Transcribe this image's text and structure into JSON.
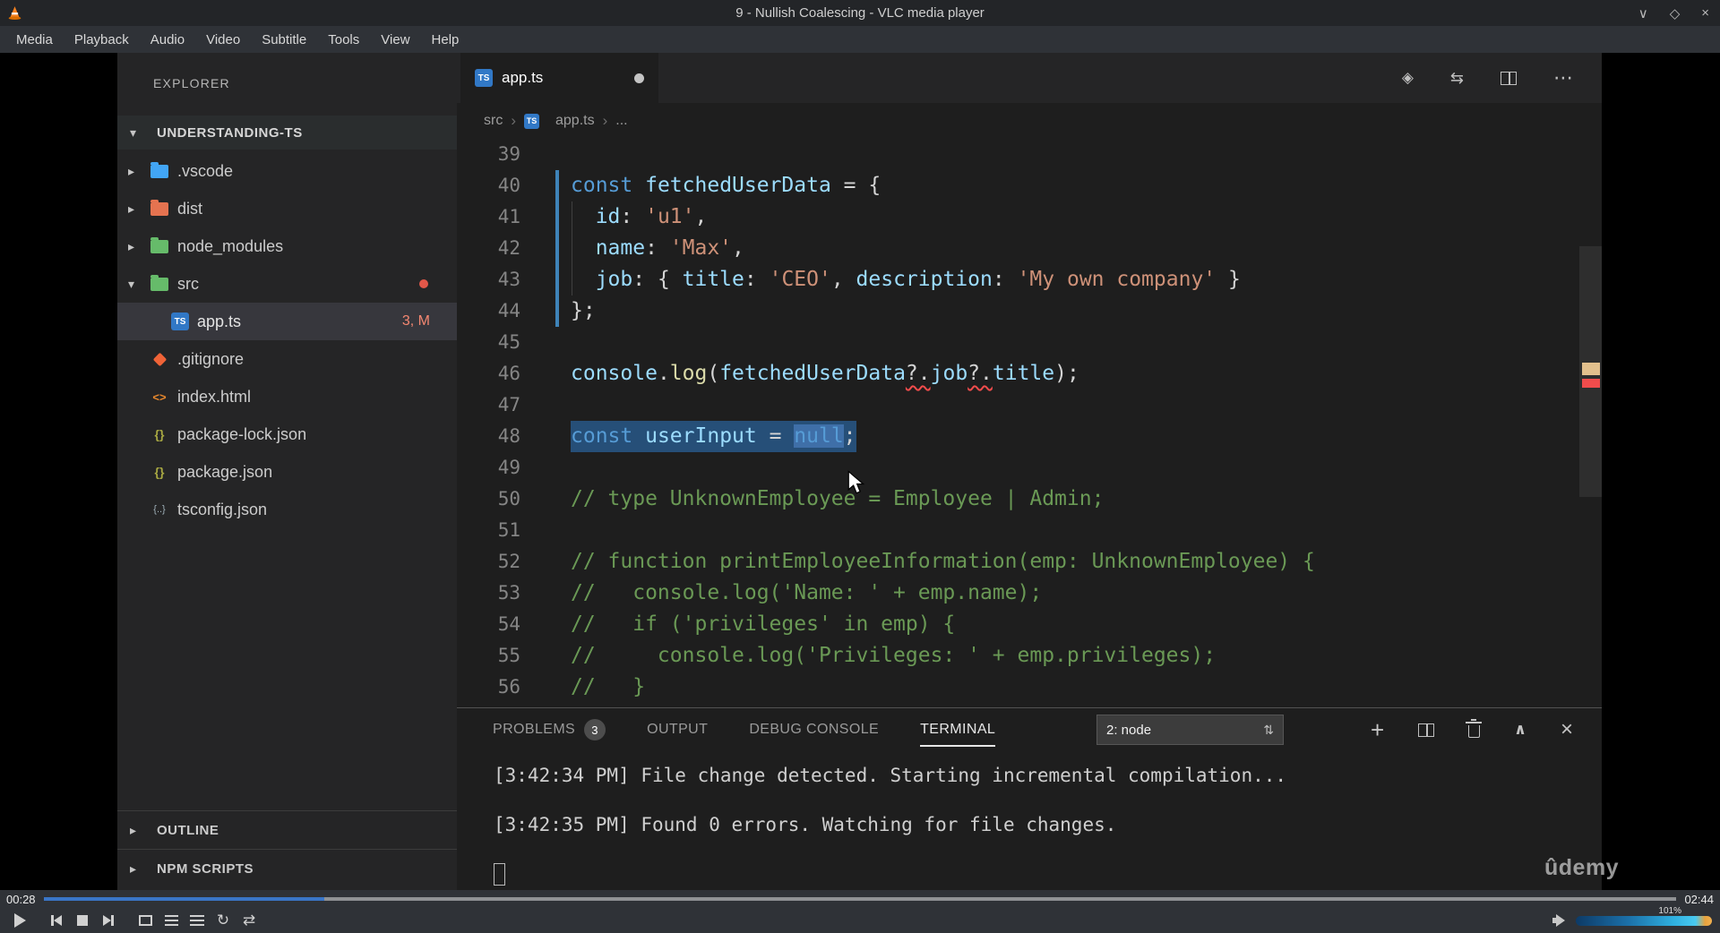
{
  "vlc": {
    "window_title": "9 - Nullish Coalescing - VLC media player",
    "menu": [
      "Media",
      "Playback",
      "Audio",
      "Video",
      "Subtitle",
      "Tools",
      "View",
      "Help"
    ],
    "time_elapsed": "00:28",
    "time_total": "02:44",
    "progress_percent": 17.2,
    "volume_percent": "101%"
  },
  "vscode": {
    "explorer": {
      "title": "EXPLORER",
      "workspace": "UNDERSTANDING-TS",
      "items": [
        {
          "label": ".vscode",
          "icon": "folder",
          "icon_color": "#42a5f5",
          "chevron": "collapsed",
          "indent": 0
        },
        {
          "label": "dist",
          "icon": "folder",
          "icon_color": "#e57350",
          "chevron": "collapsed",
          "indent": 0
        },
        {
          "label": "node_modules",
          "icon": "folder",
          "icon_color": "#66bb6a",
          "chevron": "collapsed",
          "indent": 0
        },
        {
          "label": "src",
          "icon": "folder",
          "icon_color": "#66bb6a",
          "chevron": "expanded",
          "indent": 0,
          "dot": true
        },
        {
          "label": "app.ts",
          "icon": "ts",
          "icon_color": "#3178c6",
          "indent": 1,
          "badge": "3, M",
          "selected": true
        },
        {
          "label": ".gitignore",
          "icon": "git",
          "icon_color": "#ef6337",
          "indent": 0
        },
        {
          "label": "index.html",
          "icon": "html",
          "icon_color": "#e8882d",
          "indent": 0
        },
        {
          "label": "package-lock.json",
          "icon": "braces",
          "icon_color": "#a8a842",
          "indent": 0
        },
        {
          "label": "package.json",
          "icon": "braces",
          "icon_color": "#a8a842",
          "indent": 0
        },
        {
          "label": "tsconfig.json",
          "icon": "braces-dot",
          "icon_color": "#9fb0b8",
          "indent": 0
        }
      ],
      "bottom_sections": [
        "OUTLINE",
        "NPM SCRIPTS"
      ]
    },
    "tab": {
      "label": "app.ts",
      "modified": true
    },
    "breadcrumb": [
      "src",
      "app.ts",
      "..."
    ],
    "editor": {
      "lines": [
        {
          "n": 39,
          "tok": []
        },
        {
          "n": 40,
          "tok": [
            [
              "k",
              "const"
            ],
            [
              "p",
              " "
            ],
            [
              "v",
              "fetchedUserData"
            ],
            [
              "p",
              " = {"
            ]
          ]
        },
        {
          "n": 41,
          "tok": [
            [
              "p",
              "  "
            ],
            [
              "v",
              "id"
            ],
            [
              "p",
              ": "
            ],
            [
              "s",
              "'u1'"
            ],
            [
              "p",
              ","
            ]
          ]
        },
        {
          "n": 42,
          "tok": [
            [
              "p",
              "  "
            ],
            [
              "v",
              "name"
            ],
            [
              "p",
              ": "
            ],
            [
              "s",
              "'Max'"
            ],
            [
              "p",
              ","
            ]
          ]
        },
        {
          "n": 43,
          "tok": [
            [
              "p",
              "  "
            ],
            [
              "v",
              "job"
            ],
            [
              "p",
              ": { "
            ],
            [
              "v",
              "title"
            ],
            [
              "p",
              ": "
            ],
            [
              "s",
              "'CEO'"
            ],
            [
              "p",
              ", "
            ],
            [
              "v",
              "description"
            ],
            [
              "p",
              ": "
            ],
            [
              "s",
              "'My own company'"
            ],
            [
              "p",
              " }"
            ]
          ]
        },
        {
          "n": 44,
          "tok": [
            [
              "p",
              "};"
            ]
          ]
        },
        {
          "n": 45,
          "tok": []
        },
        {
          "n": 46,
          "tok": [
            [
              "v",
              "console"
            ],
            [
              "p",
              "."
            ],
            [
              "f",
              "log"
            ],
            [
              "p",
              "("
            ],
            [
              "v",
              "fetchedUserData"
            ],
            [
              "e",
              "?."
            ],
            [
              "v",
              "job"
            ],
            [
              "e",
              "?."
            ],
            [
              "v",
              "title"
            ],
            [
              "p",
              ");"
            ]
          ]
        },
        {
          "n": 47,
          "tok": []
        },
        {
          "n": 48,
          "sel": true,
          "tok": [
            [
              "k",
              "const"
            ],
            [
              "p",
              " "
            ],
            [
              "v",
              "userInput"
            ],
            [
              "p",
              " = "
            ],
            [
              "kh",
              "null"
            ],
            [
              "p",
              ";"
            ]
          ]
        },
        {
          "n": 49,
          "tok": []
        },
        {
          "n": 50,
          "tok": [
            [
              "c",
              "// type UnknownEmployee = Employee | Admin;"
            ]
          ]
        },
        {
          "n": 51,
          "tok": []
        },
        {
          "n": 52,
          "tok": [
            [
              "c",
              "// function printEmployeeInformation(emp: UnknownEmployee) {"
            ]
          ]
        },
        {
          "n": 53,
          "tok": [
            [
              "c",
              "//   console.log('Name: ' + emp.name);"
            ]
          ]
        },
        {
          "n": 54,
          "tok": [
            [
              "c",
              "//   if ('privileges' in emp) {"
            ]
          ]
        },
        {
          "n": 55,
          "tok": [
            [
              "c",
              "//     console.log('Privileges: ' + emp.privileges);"
            ]
          ]
        },
        {
          "n": 56,
          "tok": [
            [
              "c",
              "//   }"
            ]
          ]
        }
      ]
    },
    "panel": {
      "tabs": [
        {
          "label": "PROBLEMS",
          "badge": "3"
        },
        {
          "label": "OUTPUT"
        },
        {
          "label": "DEBUG CONSOLE"
        },
        {
          "label": "TERMINAL",
          "active": true
        }
      ],
      "shell_selector": "2: node",
      "terminal_lines": [
        "[3:42:34 PM] File change detected. Starting incremental compilation...",
        "[3:42:35 PM] Found 0 errors. Watching for file changes."
      ]
    }
  },
  "watermark": "ûdemy",
  "colors": {
    "selection": "#264f78",
    "error": "#f14c4c",
    "decoration_badge": "#f48771",
    "seek_progress": "#3a76c8",
    "ts_brand": "#3178c6"
  }
}
